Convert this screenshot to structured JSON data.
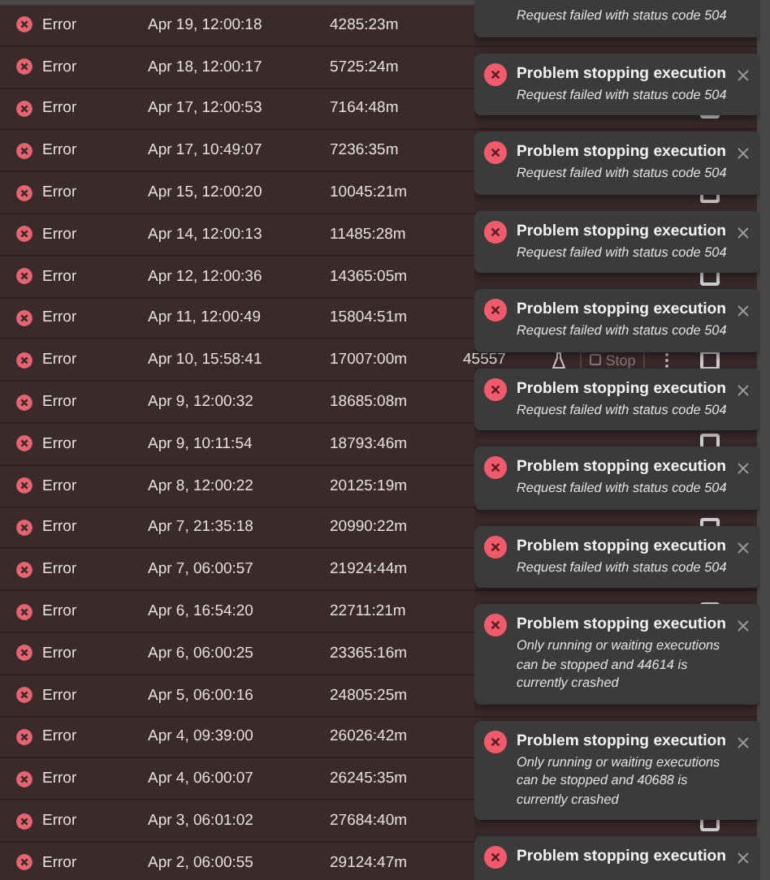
{
  "executions": [
    {
      "status": "Error",
      "started": "Apr 19, 12:00:18",
      "runtime": "4285:23m"
    },
    {
      "status": "Error",
      "started": "Apr 18, 12:00:17",
      "runtime": "5725:24m"
    },
    {
      "status": "Error",
      "started": "Apr 17, 12:00:53",
      "runtime": "7164:48m",
      "checked": false
    },
    {
      "status": "Error",
      "started": "Apr 17, 10:49:07",
      "runtime": "7236:35m"
    },
    {
      "status": "Error",
      "started": "Apr 15, 12:00:20",
      "runtime": "10045:21m",
      "checked": false
    },
    {
      "status": "Error",
      "started": "Apr 14, 12:00:13",
      "runtime": "11485:28m"
    },
    {
      "status": "Error",
      "started": "Apr 12, 12:00:36",
      "runtime": "14365:05m",
      "checked": false
    },
    {
      "status": "Error",
      "started": "Apr 11, 12:00:49",
      "runtime": "15804:51m"
    },
    {
      "status": "Error",
      "started": "Apr 10, 15:58:41",
      "runtime": "17007:00m",
      "id": "45557",
      "test_run": true,
      "stop": "Stop",
      "checked": false
    },
    {
      "status": "Error",
      "started": "Apr 9, 12:00:32",
      "runtime": "18685:08m"
    },
    {
      "status": "Error",
      "started": "Apr 9, 10:11:54",
      "runtime": "18793:46m",
      "checked": false
    },
    {
      "status": "Error",
      "started": "Apr 8, 12:00:22",
      "runtime": "20125:19m"
    },
    {
      "status": "Error",
      "started": "Apr 7, 21:35:18",
      "runtime": "20990:22m",
      "checked": false
    },
    {
      "status": "Error",
      "started": "Apr 7, 06:00:57",
      "runtime": "21924:44m"
    },
    {
      "status": "Error",
      "started": "Apr 6, 16:54:20",
      "runtime": "22711:21m",
      "checked": false
    },
    {
      "status": "Error",
      "started": "Apr 6, 06:00:25",
      "runtime": "23365:16m"
    },
    {
      "status": "Error",
      "started": "Apr 5, 06:00:16",
      "runtime": "24805:25m"
    },
    {
      "status": "Error",
      "started": "Apr 4, 09:39:00",
      "runtime": "26026:42m"
    },
    {
      "status": "Error",
      "started": "Apr 4, 06:00:07",
      "runtime": "26245:35m"
    },
    {
      "status": "Error",
      "started": "Apr 3, 06:01:02",
      "runtime": "27684:40m",
      "checked": false
    },
    {
      "status": "Error",
      "started": "Apr 2, 06:00:55",
      "runtime": "29124:47m"
    }
  ],
  "toasts": [
    {
      "message": "Request failed with status code 504"
    },
    {
      "title": "Problem stopping execution",
      "message": "Request failed with status code 504"
    },
    {
      "title": "Problem stopping execution",
      "message": "Request failed with status code 504"
    },
    {
      "title": "Problem stopping execution",
      "message": "Request failed with status code 504"
    },
    {
      "title": "Problem stopping execution",
      "message": "Request failed with status code 504"
    },
    {
      "title": "Problem stopping execution",
      "message": "Request failed with status code 504"
    },
    {
      "title": "Problem stopping execution",
      "message": "Request failed with status code 504"
    },
    {
      "title": "Problem stopping execution",
      "message": "Request failed with status code 504"
    },
    {
      "title": "Problem stopping execution",
      "message": "Only running or waiting executions can be stopped and 44614 is currently crashed"
    },
    {
      "title": "Problem stopping execution",
      "message": "Only running or waiting executions can be stopped and 40688 is currently crashed"
    },
    {
      "title": "Problem stopping execution"
    }
  ]
}
